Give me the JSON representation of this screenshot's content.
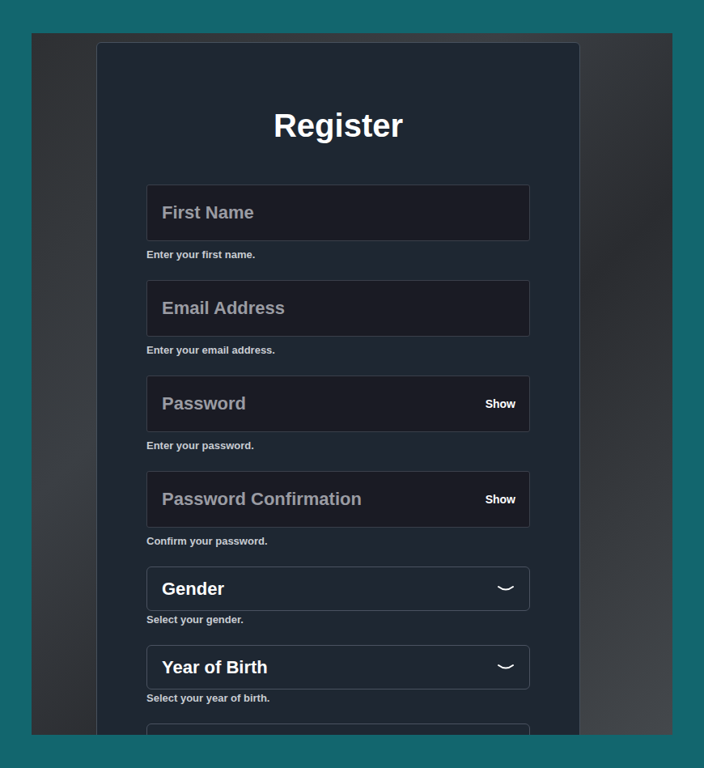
{
  "form": {
    "title": "Register",
    "fields": [
      {
        "kind": "input",
        "placeholder": "First Name",
        "help": "Enter your first name.",
        "toggle": ""
      },
      {
        "kind": "input",
        "placeholder": "Email Address",
        "help": "Enter your email address.",
        "toggle": ""
      },
      {
        "kind": "input",
        "placeholder": "Password",
        "help": "Enter your password.",
        "toggle": "Show"
      },
      {
        "kind": "input",
        "placeholder": "Password Confirmation",
        "help": "Confirm your password.",
        "toggle": "Show"
      },
      {
        "kind": "select",
        "placeholder": "Gender",
        "help": "Select your gender.",
        "toggle": ""
      },
      {
        "kind": "select",
        "placeholder": "Year of Birth",
        "help": "Select your year of birth.",
        "toggle": ""
      },
      {
        "kind": "select",
        "placeholder": "",
        "help": "",
        "toggle": ""
      }
    ]
  }
}
